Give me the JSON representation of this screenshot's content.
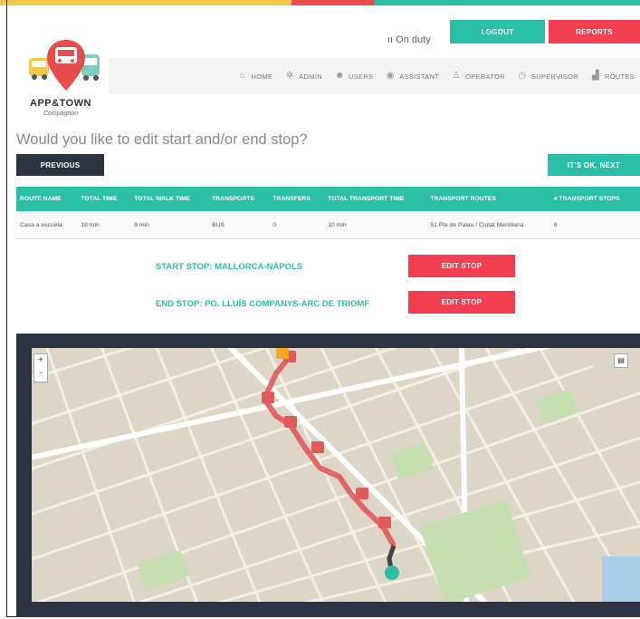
{
  "colors": {
    "teal": "#2bbfa6",
    "red": "#f23f4f",
    "navy": "#2d3340",
    "route": "#e05a5a",
    "orange": "#f5a623"
  },
  "header": {
    "status": "On duty",
    "logout_label": "LOGOUT",
    "reports_label": "REPORTS",
    "logo_text": "APP&TOWN",
    "logo_sub": "Compagnon"
  },
  "nav": [
    {
      "label": "HOME",
      "icon": "home-icon"
    },
    {
      "label": "ADMIN",
      "icon": "gear-icon"
    },
    {
      "label": "USERS",
      "icon": "users-icon"
    },
    {
      "label": "ASSISTANT",
      "icon": "chat-icon"
    },
    {
      "label": "OPERATOR",
      "icon": "person-icon"
    },
    {
      "label": "SUPERVISOR",
      "icon": "clock-icon"
    },
    {
      "label": "ROUTES",
      "icon": "chart-icon"
    }
  ],
  "main": {
    "question": "Would you like to edit start and/or end stop?",
    "previous_label": "PREVIOUS",
    "next_label": "IT'S OK, NEXT"
  },
  "table": {
    "headers": [
      "ROUTE NAME",
      "TOTAL TIME",
      "TOTAL WALK TIME",
      "TRANSPORTS",
      "TRANSFERS",
      "TOTAL TRANSPORT TIME",
      "TRANSPORT ROUTES",
      "# TRANSPORT STOPS"
    ],
    "rows": [
      [
        "Casa a escuela",
        "18 min",
        "8 min",
        "BUS",
        "0",
        "10 min",
        "51 Pla de Palau / Ciutat Meridiana",
        "6"
      ]
    ]
  },
  "stops": {
    "start_prefix": "START STOP:",
    "start_name": "MALLORCA-NÀPOLS",
    "end_prefix": "END STOP:",
    "end_name": "PG. LLUÍS COMPANYS-ARC DE TRIOMF",
    "edit_label": "EDIT STOP"
  },
  "map": {
    "zoom_in": "+",
    "zoom_out": "-",
    "start_marker": "S",
    "end_marker": "F"
  }
}
